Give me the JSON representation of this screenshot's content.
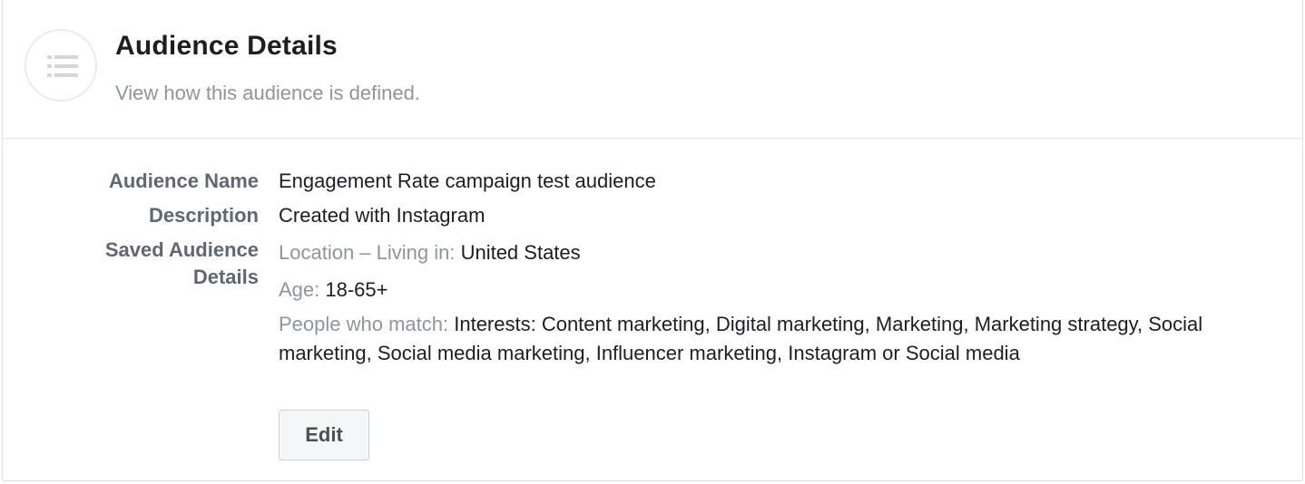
{
  "header": {
    "title": "Audience Details",
    "subtitle": "View how this audience is defined.",
    "icon": "list-icon"
  },
  "details": {
    "audience_name_label": "Audience Name",
    "audience_name_value": "Engagement Rate campaign test audience",
    "description_label": "Description",
    "description_value": "Created with Instagram",
    "saved_details_label_line1": "Saved Audience",
    "saved_details_label_line2": "Details",
    "location_label": "Location – Living in: ",
    "location_value": "United States",
    "age_label": "Age: ",
    "age_value": "18-65+",
    "people_label": "People who match: ",
    "people_value": "Interests: Content marketing, Digital marketing, Marketing, Marketing strategy, Social marketing, Social media marketing, Influencer marketing, Instagram or Social media"
  },
  "actions": {
    "edit_label": "Edit"
  },
  "colors": {
    "label_gray": "#606770",
    "muted_gray": "#90949c",
    "text": "#1c1e21",
    "border": "#dddfe2"
  }
}
